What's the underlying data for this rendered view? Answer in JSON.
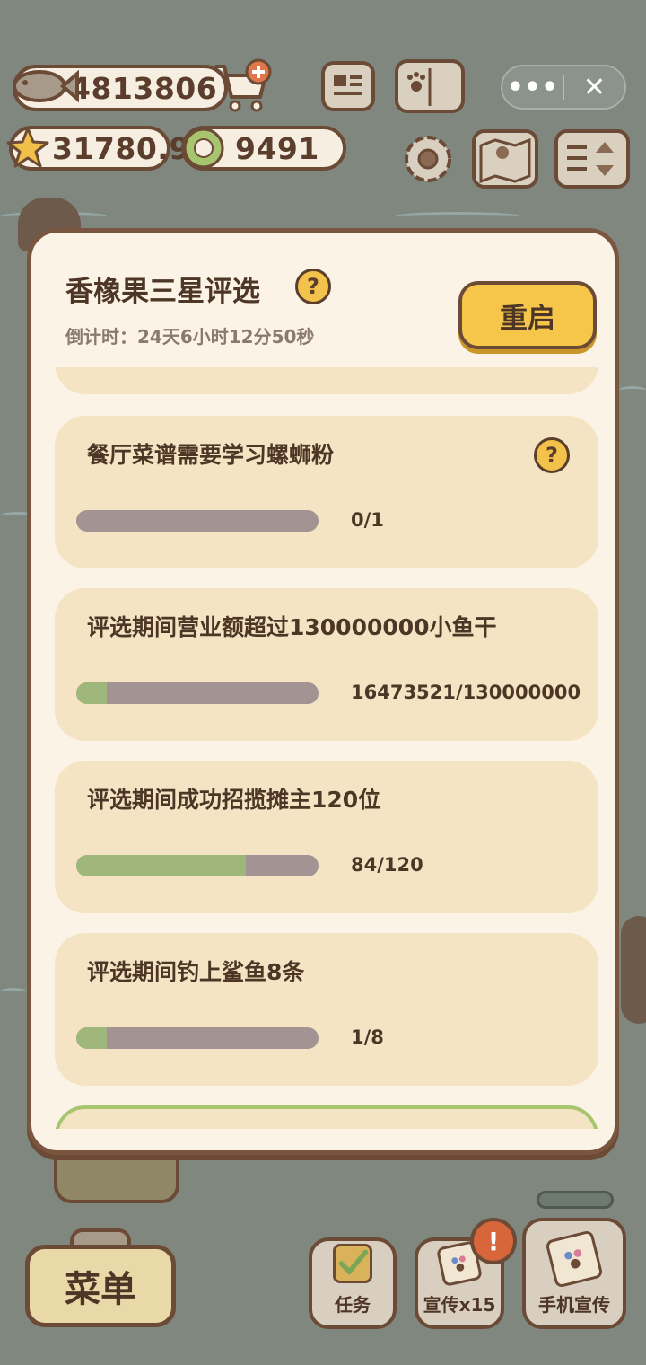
{
  "top": {
    "fish_coins": "4813806",
    "stars": "31780.9",
    "gems": "9491"
  },
  "modal": {
    "title": "香橡果三星评选",
    "countdown": "倒计时：24天6小时12分50秒",
    "restart_label": "重启",
    "tasks": [
      {
        "title": "餐厅菜谱需要学习螺蛳粉",
        "count": "0/1",
        "progress": 0.0,
        "has_help": true
      },
      {
        "title": "评选期间营业额超过130000000小鱼干",
        "count": "16473521/130000000",
        "progress": 0.127,
        "has_help": false
      },
      {
        "title": "评选期间成功招揽摊主120位",
        "count": "84/120",
        "progress": 0.7,
        "has_help": false
      },
      {
        "title": "评选期间钓上鲨鱼8条",
        "count": "1/8",
        "progress": 0.125,
        "has_help": false
      }
    ]
  },
  "bottom": {
    "menu_label": "菜单",
    "task_label": "任务",
    "promote_label": "宣传x15",
    "phone_promote_label": "手机宣传",
    "alert_symbol": "!"
  },
  "icons": {
    "help_symbol": "?",
    "more": "•••",
    "close": "✕"
  },
  "colors": {
    "progress_fill": "#9fb77b",
    "progress_track": "#a39393",
    "accent_button": "#f6c64a",
    "alert": "#d7663a"
  }
}
